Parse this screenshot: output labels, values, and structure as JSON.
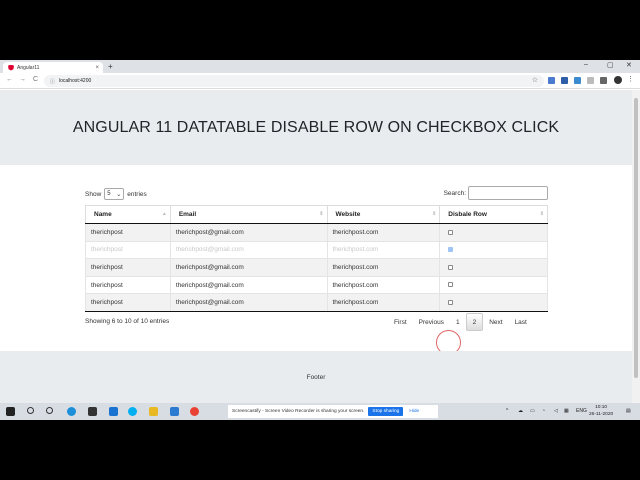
{
  "browser": {
    "tab_title": "Angular11",
    "tab_close": "×",
    "new_tab": "+",
    "url": "localhost:4200",
    "back": "←",
    "forward": "→",
    "reload": "C",
    "min": "–",
    "max": "▢",
    "close": "✕"
  },
  "page": {
    "heading": "ANGULAR 11 DATATABLE DISABLE ROW ON CHECKBOX CLICK",
    "show_label": "Show",
    "entries_value": "5",
    "entries_label": "entries",
    "search_label": "Search:",
    "columns": [
      "Name",
      "Email",
      "Website",
      "Disbale Row"
    ],
    "rows": [
      {
        "name": "therichpost",
        "email": "therichpost@gmail.com",
        "website": "therichpost.com",
        "checked": false,
        "disabled": false
      },
      {
        "name": "therichpost",
        "email": "therichpost@gmail.com",
        "website": "therichpost.com",
        "checked": true,
        "disabled": true
      },
      {
        "name": "therichpost",
        "email": "therichpost@gmail.com",
        "website": "therichpost.com",
        "checked": false,
        "disabled": false
      },
      {
        "name": "therichpost",
        "email": "therichpost@gmail.com",
        "website": "therichpost.com",
        "checked": false,
        "disabled": false
      },
      {
        "name": "therichpost",
        "email": "therichpost@gmail.com",
        "website": "therichpost.com",
        "checked": false,
        "disabled": false
      }
    ],
    "info": "Showing 6 to 10 of 10 entries",
    "pager": {
      "first": "First",
      "previous": "Previous",
      "page1": "1",
      "page2": "2",
      "next": "Next",
      "last": "Last"
    },
    "footer": "Footer"
  },
  "taskbar": {
    "notice_text": "Screencastify - Screen Video Recorder is sharing your screen.",
    "stop_label": "Stop sharing",
    "hide_label": "Hide",
    "language": "ENG",
    "time": "10:10",
    "date": "26-11-2020"
  },
  "colors": {
    "hero_bg": "#e9ecef",
    "accent": "#1a73e8",
    "checked": "#9ec5f5"
  }
}
